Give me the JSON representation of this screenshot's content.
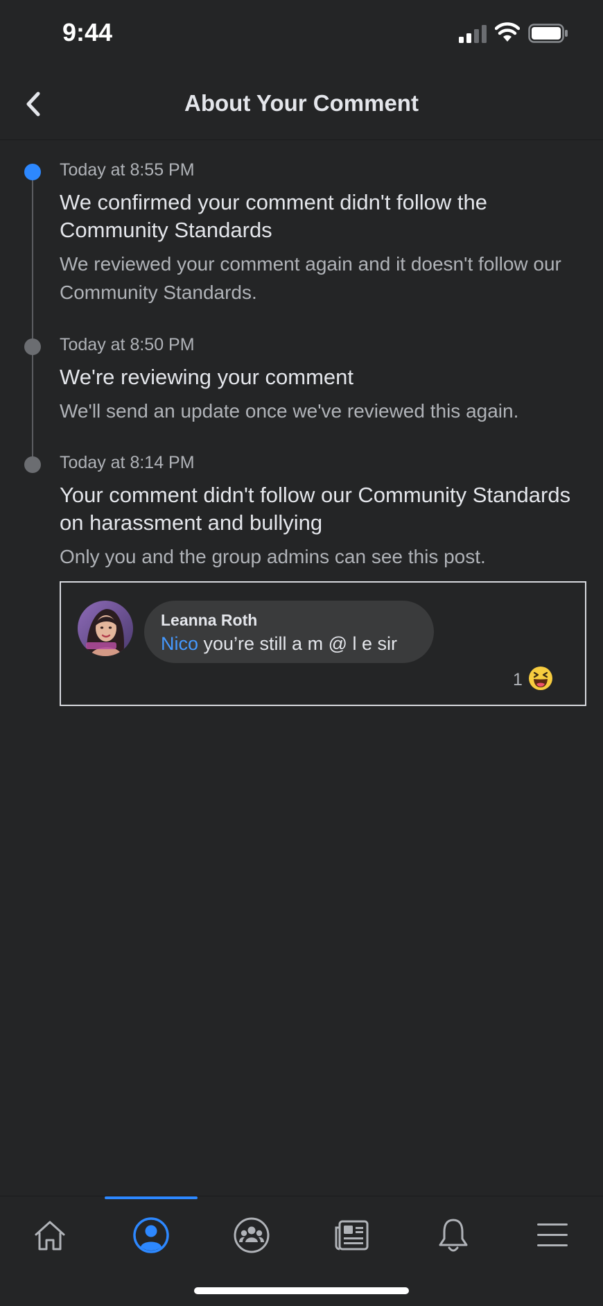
{
  "status_bar": {
    "time": "9:44"
  },
  "header": {
    "title": "About Your Comment"
  },
  "timeline": [
    {
      "time": "Today at 8:55 PM",
      "title": "We confirmed your comment didn't follow the Community Standards",
      "description": "We reviewed your comment again and it doesn't follow our Community Standards.",
      "active": true
    },
    {
      "time": "Today at 8:50 PM",
      "title": "We're reviewing your comment",
      "description": "We'll send an update once we've reviewed this again.",
      "active": false
    },
    {
      "time": "Today at 8:14 PM",
      "title": "Your comment didn't follow our Community Standards on harassment and bullying",
      "description": "Only you and the group admins can see this post.",
      "active": false
    }
  ],
  "comment": {
    "author": "Leanna Roth",
    "mention": "Nico",
    "text": " you’re still a m @ l e sir",
    "reaction_count": "1",
    "reaction_icon": "haha-emoji"
  },
  "bottom_nav": {
    "items": [
      "home-icon",
      "profile-icon",
      "groups-icon",
      "news-feed-icon",
      "notifications-icon",
      "menu-icon"
    ],
    "active": "profile-icon"
  },
  "colors": {
    "accent": "#2d88ff",
    "background": "#242526",
    "bubble": "#3a3b3c",
    "mention": "#4599ff"
  }
}
